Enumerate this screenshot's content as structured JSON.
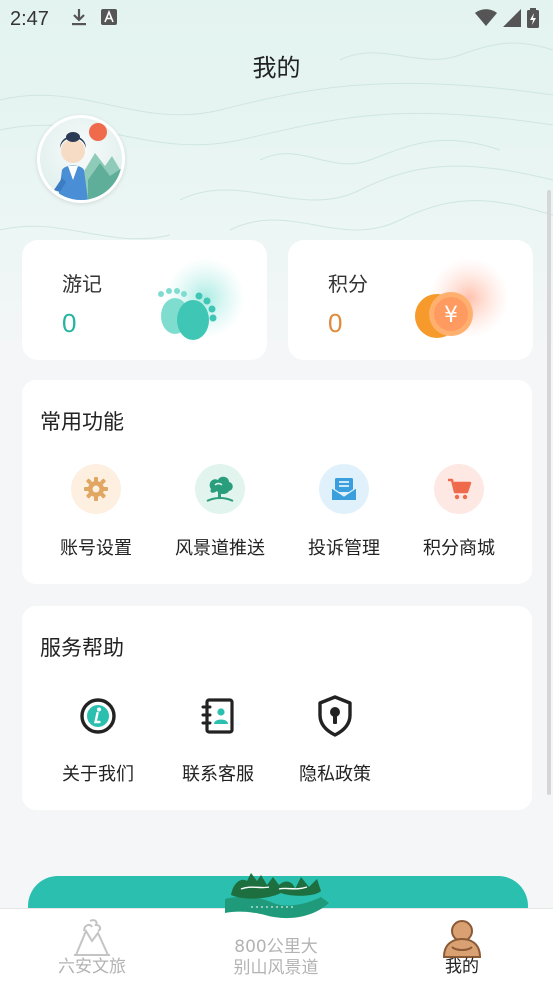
{
  "status_bar": {
    "time": "2:47"
  },
  "page": {
    "title": "我的"
  },
  "stats": [
    {
      "label": "游记",
      "value": "0"
    },
    {
      "label": "积分",
      "value": "0"
    }
  ],
  "common_functions": {
    "title": "常用功能",
    "items": [
      {
        "label": "账号设置",
        "icon": "gear-icon",
        "bg": "#fdf0e0",
        "color": "#e2a663"
      },
      {
        "label": "风景道推送",
        "icon": "tree-landscape-icon",
        "bg": "#e2f4ee",
        "color": "#2a9d7c"
      },
      {
        "label": "投诉管理",
        "icon": "mail-inbox-icon",
        "bg": "#e1f1fb",
        "color": "#3a9fdc"
      },
      {
        "label": "积分商城",
        "icon": "shopping-cart-icon",
        "bg": "#fde8e3",
        "color": "#ef6a4a"
      }
    ]
  },
  "service_help": {
    "title": "服务帮助",
    "items": [
      {
        "label": "关于我们",
        "icon": "info-icon"
      },
      {
        "label": "联系客服",
        "icon": "contact-book-icon"
      },
      {
        "label": "隐私政策",
        "icon": "shield-lock-icon"
      }
    ]
  },
  "tab_bar": {
    "tabs": [
      {
        "label": "六安文旅",
        "icon": "mountain-icon",
        "active": false
      },
      {
        "label_line1": "800公里大",
        "label_line2": "别山风景道",
        "icon": "dabie-logo-icon",
        "active": false
      },
      {
        "label": "我的",
        "icon": "person-icon",
        "active": true
      }
    ]
  },
  "colors": {
    "accent_teal": "#24b5a2",
    "accent_orange": "#e08a3b",
    "banner_teal": "#2bbfb0"
  }
}
